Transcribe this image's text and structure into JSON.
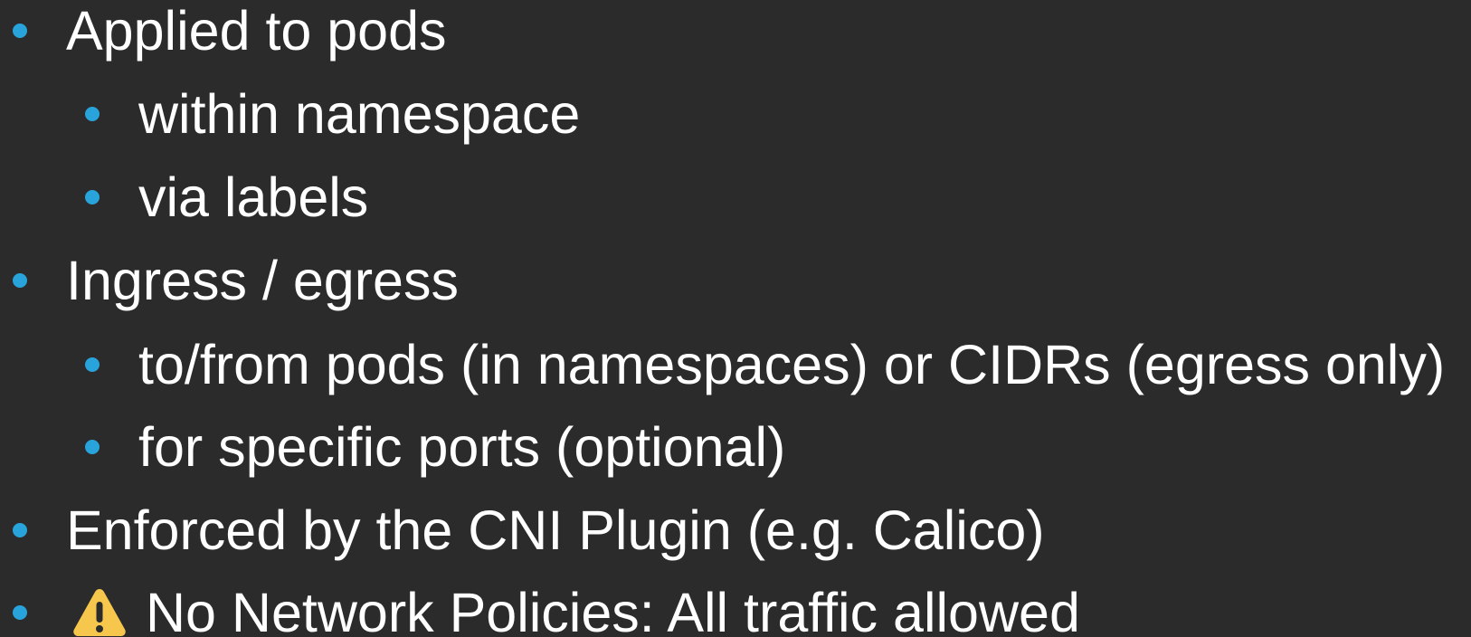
{
  "bullets": [
    {
      "level": 1,
      "text": "Applied to pods"
    },
    {
      "level": 2,
      "text": "within namespace"
    },
    {
      "level": 2,
      "text": "via labels"
    },
    {
      "level": 1,
      "text": "Ingress / egress"
    },
    {
      "level": 2,
      "text": "to/from pods (in namespaces) or CIDRs (egress only)"
    },
    {
      "level": 2,
      "text": "for specific ports (optional)"
    },
    {
      "level": 1,
      "text": "Enforced by the CNI Plugin (e.g. Calico)"
    },
    {
      "level": 1,
      "icon": "warning-icon",
      "text": "No Network Policies: All traffic allowed"
    }
  ],
  "colors": {
    "background": "#2b2b2b",
    "bullet": "#29a3dc",
    "text": "#ffffff",
    "warning": "#f7c64c"
  }
}
